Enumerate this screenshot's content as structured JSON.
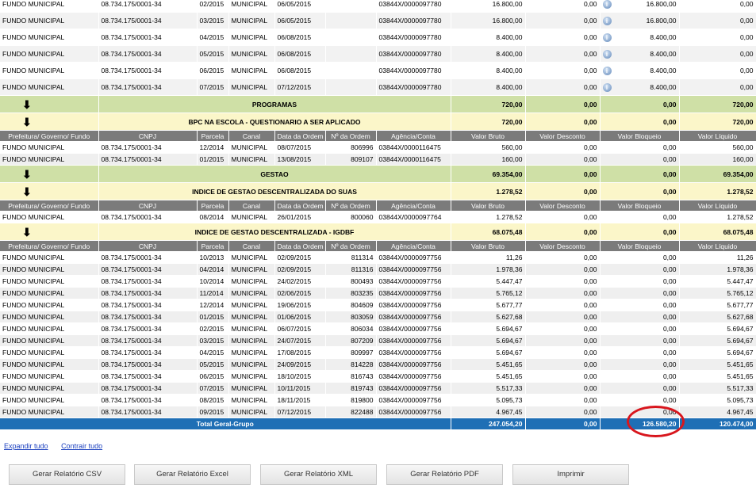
{
  "top_rows": [
    {
      "fundo": "FUNDO MUNICIPAL",
      "cnpj": "08.734.175/0001-34",
      "parcela": "02/2015",
      "canal": "MUNICIPAL",
      "data": "06/05/2015",
      "ordem": "",
      "agencia": "03844X/0000097780",
      "bruto": "16.800,00",
      "desconto": "0,00",
      "bloqueio": "16.800,00",
      "liquido": "0,00"
    },
    {
      "fundo": "FUNDO MUNICIPAL",
      "cnpj": "08.734.175/0001-34",
      "parcela": "03/2015",
      "canal": "MUNICIPAL",
      "data": "06/05/2015",
      "ordem": "",
      "agencia": "03844X/0000097780",
      "bruto": "16.800,00",
      "desconto": "0,00",
      "bloqueio": "16.800,00",
      "liquido": "0,00"
    },
    {
      "fundo": "FUNDO MUNICIPAL",
      "cnpj": "08.734.175/0001-34",
      "parcela": "04/2015",
      "canal": "MUNICIPAL",
      "data": "06/08/2015",
      "ordem": "",
      "agencia": "03844X/0000097780",
      "bruto": "8.400,00",
      "desconto": "0,00",
      "bloqueio": "8.400,00",
      "liquido": "0,00"
    },
    {
      "fundo": "FUNDO MUNICIPAL",
      "cnpj": "08.734.175/0001-34",
      "parcela": "05/2015",
      "canal": "MUNICIPAL",
      "data": "06/08/2015",
      "ordem": "",
      "agencia": "03844X/0000097780",
      "bruto": "8.400,00",
      "desconto": "0,00",
      "bloqueio": "8.400,00",
      "liquido": "0,00"
    },
    {
      "fundo": "FUNDO MUNICIPAL",
      "cnpj": "08.734.175/0001-34",
      "parcela": "06/2015",
      "canal": "MUNICIPAL",
      "data": "06/08/2015",
      "ordem": "",
      "agencia": "03844X/0000097780",
      "bruto": "8.400,00",
      "desconto": "0,00",
      "bloqueio": "8.400,00",
      "liquido": "0,00"
    },
    {
      "fundo": "FUNDO MUNICIPAL",
      "cnpj": "08.734.175/0001-34",
      "parcela": "07/2015",
      "canal": "MUNICIPAL",
      "data": "07/12/2015",
      "ordem": "",
      "agencia": "03844X/0000097780",
      "bruto": "8.400,00",
      "desconto": "0,00",
      "bloqueio": "8.400,00",
      "liquido": "0,00"
    }
  ],
  "headers": [
    "Prefeitura/ Governo/ Fundo",
    "CNPJ",
    "Parcela",
    "Canal",
    "Data da Ordem",
    "Nº da Ordem",
    "Agência/Conta",
    "Valor Bruto",
    "Valor Desconto",
    "Valor Bloqueio",
    "Valor Líquido"
  ],
  "programas": {
    "label": "PROGRAMAS",
    "bruto": "720,00",
    "desconto": "0,00",
    "bloqueio": "0,00",
    "liquido": "720,00"
  },
  "bpc": {
    "label": "BPC NA ESCOLA - QUESTIONARIO A SER APLICADO",
    "bruto": "720,00",
    "desconto": "0,00",
    "bloqueio": "0,00",
    "liquido": "720,00"
  },
  "bpc_rows": [
    {
      "fundo": "FUNDO MUNICIPAL",
      "cnpj": "08.734.175/0001-34",
      "parcela": "12/2014",
      "canal": "MUNICIPAL",
      "data": "08/07/2015",
      "ordem": "806996",
      "agencia": "03844X/0000116475",
      "bruto": "560,00",
      "desconto": "0,00",
      "bloqueio": "0,00",
      "liquido": "560,00"
    },
    {
      "fundo": "FUNDO MUNICIPAL",
      "cnpj": "08.734.175/0001-34",
      "parcela": "01/2015",
      "canal": "MUNICIPAL",
      "data": "13/08/2015",
      "ordem": "809107",
      "agencia": "03844X/0000116475",
      "bruto": "160,00",
      "desconto": "0,00",
      "bloqueio": "0,00",
      "liquido": "160,00"
    }
  ],
  "gestao": {
    "label": "GESTAO",
    "bruto": "69.354,00",
    "desconto": "0,00",
    "bloqueio": "0,00",
    "liquido": "69.354,00"
  },
  "igdsuas": {
    "label": "INDICE DE GESTAO DESCENTRALIZADA DO SUAS",
    "bruto": "1.278,52",
    "desconto": "0,00",
    "bloqueio": "0,00",
    "liquido": "1.278,52"
  },
  "igdsuas_rows": [
    {
      "fundo": "FUNDO MUNICIPAL",
      "cnpj": "08.734.175/0001-34",
      "parcela": "08/2014",
      "canal": "MUNICIPAL",
      "data": "26/01/2015",
      "ordem": "800060",
      "agencia": "03844X/0000097764",
      "bruto": "1.278,52",
      "desconto": "0,00",
      "bloqueio": "0,00",
      "liquido": "1.278,52"
    }
  ],
  "igdbf": {
    "label": "INDICE DE GESTAO DESCENTRALIZADA - IGDBF",
    "bruto": "68.075,48",
    "desconto": "0,00",
    "bloqueio": "0,00",
    "liquido": "68.075,48"
  },
  "igdbf_rows": [
    {
      "fundo": "FUNDO MUNICIPAL",
      "cnpj": "08.734.175/0001-34",
      "parcela": "10/2013",
      "canal": "MUNICIPAL",
      "data": "02/09/2015",
      "ordem": "811314",
      "agencia": "03844X/0000097756",
      "bruto": "11,26",
      "desconto": "0,00",
      "bloqueio": "0,00",
      "liquido": "11,26"
    },
    {
      "fundo": "FUNDO MUNICIPAL",
      "cnpj": "08.734.175/0001-34",
      "parcela": "04/2014",
      "canal": "MUNICIPAL",
      "data": "02/09/2015",
      "ordem": "811316",
      "agencia": "03844X/0000097756",
      "bruto": "1.978,36",
      "desconto": "0,00",
      "bloqueio": "0,00",
      "liquido": "1.978,36"
    },
    {
      "fundo": "FUNDO MUNICIPAL",
      "cnpj": "08.734.175/0001-34",
      "parcela": "10/2014",
      "canal": "MUNICIPAL",
      "data": "24/02/2015",
      "ordem": "800493",
      "agencia": "03844X/0000097756",
      "bruto": "5.447,47",
      "desconto": "0,00",
      "bloqueio": "0,00",
      "liquido": "5.447,47"
    },
    {
      "fundo": "FUNDO MUNICIPAL",
      "cnpj": "08.734.175/0001-34",
      "parcela": "11/2014",
      "canal": "MUNICIPAL",
      "data": "02/06/2015",
      "ordem": "803235",
      "agencia": "03844X/0000097756",
      "bruto": "5.765,12",
      "desconto": "0,00",
      "bloqueio": "0,00",
      "liquido": "5.765,12"
    },
    {
      "fundo": "FUNDO MUNICIPAL",
      "cnpj": "08.734.175/0001-34",
      "parcela": "12/2014",
      "canal": "MUNICIPAL",
      "data": "19/06/2015",
      "ordem": "804609",
      "agencia": "03844X/0000097756",
      "bruto": "5.677,77",
      "desconto": "0,00",
      "bloqueio": "0,00",
      "liquido": "5.677,77"
    },
    {
      "fundo": "FUNDO MUNICIPAL",
      "cnpj": "08.734.175/0001-34",
      "parcela": "01/2015",
      "canal": "MUNICIPAL",
      "data": "01/06/2015",
      "ordem": "803059",
      "agencia": "03844X/0000097756",
      "bruto": "5.627,68",
      "desconto": "0,00",
      "bloqueio": "0,00",
      "liquido": "5.627,68"
    },
    {
      "fundo": "FUNDO MUNICIPAL",
      "cnpj": "08.734.175/0001-34",
      "parcela": "02/2015",
      "canal": "MUNICIPAL",
      "data": "06/07/2015",
      "ordem": "806034",
      "agencia": "03844X/0000097756",
      "bruto": "5.694,67",
      "desconto": "0,00",
      "bloqueio": "0,00",
      "liquido": "5.694,67"
    },
    {
      "fundo": "FUNDO MUNICIPAL",
      "cnpj": "08.734.175/0001-34",
      "parcela": "03/2015",
      "canal": "MUNICIPAL",
      "data": "24/07/2015",
      "ordem": "807209",
      "agencia": "03844X/0000097756",
      "bruto": "5.694,67",
      "desconto": "0,00",
      "bloqueio": "0,00",
      "liquido": "5.694,67"
    },
    {
      "fundo": "FUNDO MUNICIPAL",
      "cnpj": "08.734.175/0001-34",
      "parcela": "04/2015",
      "canal": "MUNICIPAL",
      "data": "17/08/2015",
      "ordem": "809997",
      "agencia": "03844X/0000097756",
      "bruto": "5.694,67",
      "desconto": "0,00",
      "bloqueio": "0,00",
      "liquido": "5.694,67"
    },
    {
      "fundo": "FUNDO MUNICIPAL",
      "cnpj": "08.734.175/0001-34",
      "parcela": "05/2015",
      "canal": "MUNICIPAL",
      "data": "24/09/2015",
      "ordem": "814228",
      "agencia": "03844X/0000097756",
      "bruto": "5.451,65",
      "desconto": "0,00",
      "bloqueio": "0,00",
      "liquido": "5.451,65"
    },
    {
      "fundo": "FUNDO MUNICIPAL",
      "cnpj": "08.734.175/0001-34",
      "parcela": "06/2015",
      "canal": "MUNICIPAL",
      "data": "18/10/2015",
      "ordem": "816743",
      "agencia": "03844X/0000097756",
      "bruto": "5.451,65",
      "desconto": "0,00",
      "bloqueio": "0,00",
      "liquido": "5.451,65"
    },
    {
      "fundo": "FUNDO MUNICIPAL",
      "cnpj": "08.734.175/0001-34",
      "parcela": "07/2015",
      "canal": "MUNICIPAL",
      "data": "10/11/2015",
      "ordem": "819743",
      "agencia": "03844X/0000097756",
      "bruto": "5.517,33",
      "desconto": "0,00",
      "bloqueio": "0,00",
      "liquido": "5.517,33"
    },
    {
      "fundo": "FUNDO MUNICIPAL",
      "cnpj": "08.734.175/0001-34",
      "parcela": "08/2015",
      "canal": "MUNICIPAL",
      "data": "18/11/2015",
      "ordem": "819800",
      "agencia": "03844X/0000097756",
      "bruto": "5.095,73",
      "desconto": "0,00",
      "bloqueio": "0,00",
      "liquido": "5.095,73"
    },
    {
      "fundo": "FUNDO MUNICIPAL",
      "cnpj": "08.734.175/0001-34",
      "parcela": "09/2015",
      "canal": "MUNICIPAL",
      "data": "07/12/2015",
      "ordem": "822488",
      "agencia": "03844X/0000097756",
      "bruto": "4.967,45",
      "desconto": "0,00",
      "bloqueio": "0,00",
      "liquido": "4.967,45"
    }
  ],
  "total": {
    "label": "Total Geral-Grupo",
    "bruto": "247.054,20",
    "desconto": "0,00",
    "bloqueio": "126.580,20",
    "liquido": "120.474,00"
  },
  "links": {
    "expand": "Expandir tudo",
    "collapse": "Contrair tudo"
  },
  "buttons": {
    "csv": "Gerar Relatório CSV",
    "excel": "Gerar Relatório Excel",
    "xml": "Gerar Relatório XML",
    "pdf": "Gerar Relatório PDF",
    "print": "Imprimir"
  },
  "icons": {
    "arrow": "down-arrow-icon",
    "info": "info-icon"
  },
  "colors": {
    "category": "#cfe0a6",
    "subcategory": "#fbf6c9",
    "header": "#7b7b7b",
    "total": "#1f6fb5",
    "highlight": "#d8161d"
  }
}
